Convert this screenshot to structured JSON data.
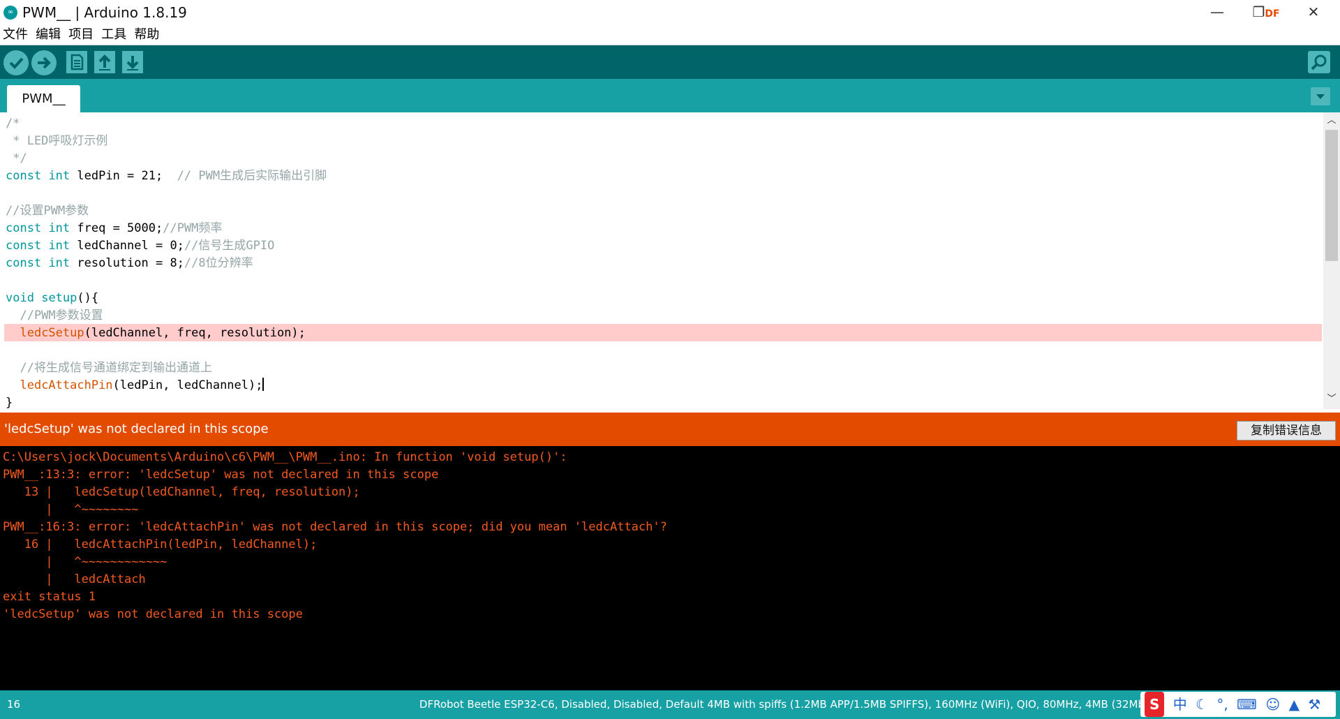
{
  "window": {
    "title": "PWM__ | Arduino 1.8.19",
    "app_icon": "arduino-infinity-icon",
    "minimize": "—",
    "restore": "❐",
    "close": "✕",
    "overlay_text": "DF"
  },
  "menu": [
    "文件",
    "编辑",
    "项目",
    "工具",
    "帮助"
  ],
  "toolbar": {
    "buttons": [
      "verify-button",
      "upload-button",
      "new-button",
      "open-button",
      "save-button"
    ],
    "serial_monitor": "serial-monitor-button"
  },
  "tabs": [
    {
      "label": "PWM__",
      "active": true
    }
  ],
  "editor": {
    "lines": [
      "/*",
      " * LED呼吸灯示例",
      " */",
      "const int ledPin = 21;  // PWM生成后实际输出引脚",
      "",
      "//设置PWM参数",
      "const int freq = 5000;//PWM频率",
      "const int ledChannel = 0;//信号生成GPIO",
      "const int resolution = 8;//8位分辨率",
      "",
      "void setup(){",
      "  //PWM参数设置",
      "  ledcSetup(ledChannel, freq, resolution);",
      "",
      "  //将生成信号通道绑定到输出通道上",
      "  ledcAttachPin(ledPin, ledChannel);",
      "}"
    ],
    "highlighted_line": 13
  },
  "error_bar": {
    "message": "'ledcSetup' was not declared in this scope",
    "copy_button": "复制错误信息",
    "color": "#e34c00"
  },
  "console": {
    "lines": [
      "C:\\Users\\jock\\Documents\\Arduino\\c6\\PWM__\\PWM__.ino: In function 'void setup()':",
      "PWM__:13:3: error: 'ledcSetup' was not declared in this scope",
      "   13 |   ledcSetup(ledChannel, freq, resolution);",
      "      |   ^~~~~~~~~",
      "PWM__:16:3: error: 'ledcAttachPin' was not declared in this scope; did you mean 'ledcAttach'?",
      "   16 |   ledcAttachPin(ledPin, ledChannel);",
      "      |   ^~~~~~~~~~~~~",
      "      |   ledcAttach",
      "exit status 1",
      "'ledcSetup' was not declared in this scope"
    ],
    "color": "#f35a1f"
  },
  "status": {
    "line": "16",
    "board": "DFRobot Beetle ESP32-C6, Disabled, Disabled, Default 4MB with spiffs (1.2MB APP/1.5MB SPIFFS), 160MHz (WiFi), QIO, 80MHz, 4MB (32Mb"
  },
  "ime": {
    "logo": "S",
    "lang": "中",
    "moon": "☾",
    "punct": "°,",
    "keyboard": "⌨",
    "user": "☺",
    "shirt": "▲",
    "wrench": "⚒"
  },
  "colors": {
    "toolbar_bg": "#006468",
    "tabbar_bg": "#17a1a5",
    "keyword": "#00979c",
    "comment": "#95a5a6",
    "highlight": "#ffcbcb"
  }
}
